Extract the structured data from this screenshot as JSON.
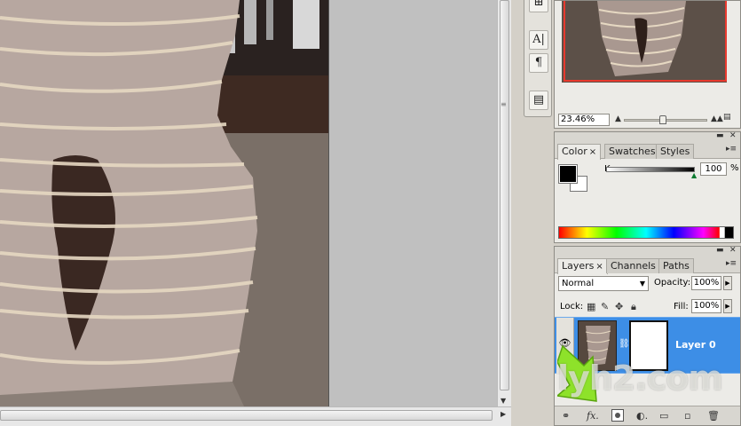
{
  "navigator": {
    "zoom_value": "23.46%",
    "zoom_level": 0.45,
    "highlight_color": "#e8392e"
  },
  "tools": {
    "items": [
      {
        "name": "layer-comps-icon"
      },
      {
        "name": "character-icon",
        "glyph": "A|"
      },
      {
        "name": "paragraph-icon",
        "glyph": "¶"
      },
      {
        "name": "notes-icon"
      }
    ]
  },
  "color_panel": {
    "tabs": [
      {
        "label": "Color",
        "active": true
      },
      {
        "label": "Swatches",
        "active": false
      },
      {
        "label": "Styles",
        "active": false
      }
    ],
    "channel_label": "K",
    "k_value": "100",
    "unit": "%",
    "fg_color": "#000000",
    "bg_color": "#ffffff"
  },
  "layers_panel": {
    "tabs": [
      {
        "label": "Layers",
        "active": true
      },
      {
        "label": "Channels",
        "active": false
      },
      {
        "label": "Paths",
        "active": false
      }
    ],
    "blend_mode": "Normal",
    "opacity_label": "Opacity:",
    "opacity_value": "100%",
    "lock_label": "Lock:",
    "fill_label": "Fill:",
    "fill_value": "100%",
    "layer_name": "Layer 0",
    "selected_color": "#3d8ee6"
  },
  "watermark": "lyh2.com"
}
